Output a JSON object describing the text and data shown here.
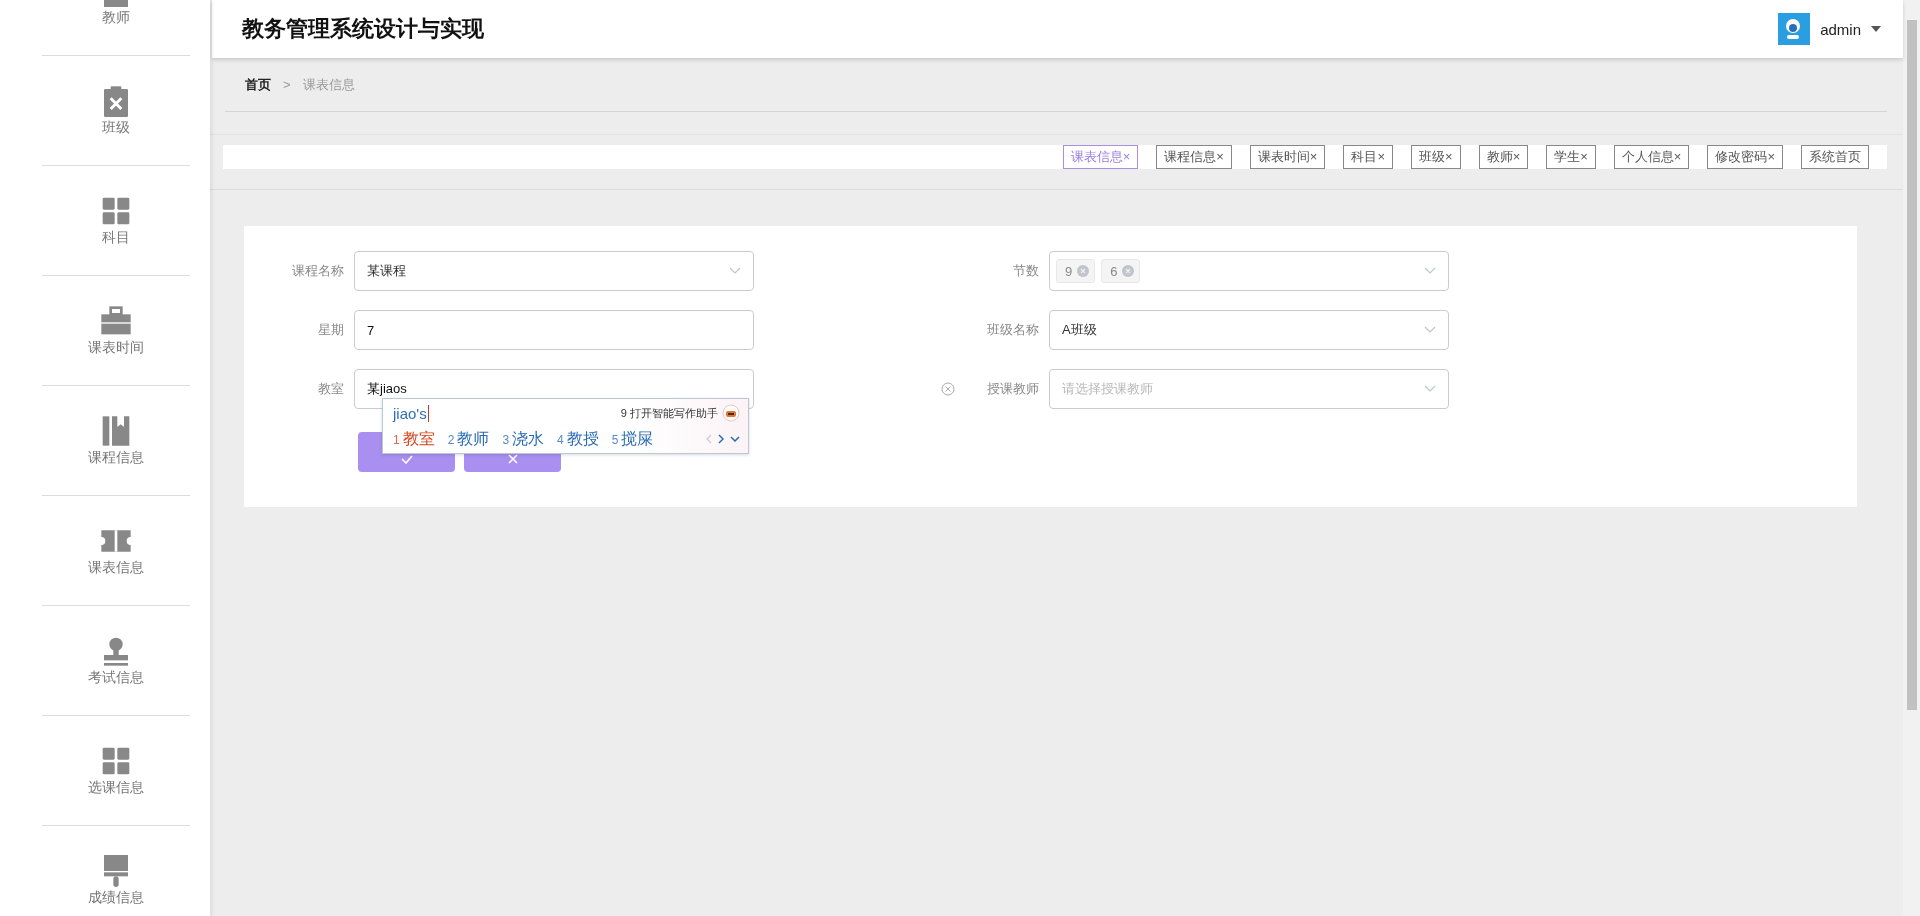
{
  "sidebar": {
    "items": [
      {
        "label": "教师"
      },
      {
        "label": "班级"
      },
      {
        "label": "科目"
      },
      {
        "label": "课表时间"
      },
      {
        "label": "课程信息"
      },
      {
        "label": "课表信息"
      },
      {
        "label": "考试信息"
      },
      {
        "label": "选课信息"
      },
      {
        "label": "成绩信息"
      }
    ]
  },
  "header": {
    "title": "教务管理系统设计与实现",
    "user": "admin"
  },
  "breadcrumb": {
    "home": "首页",
    "separator": ">",
    "current": "课表信息"
  },
  "tags": [
    {
      "label": "课表信息",
      "close": "×",
      "selected": true
    },
    {
      "label": "课程信息",
      "close": "×",
      "selected": false
    },
    {
      "label": "课表时间",
      "close": "×",
      "selected": false
    },
    {
      "label": "科目",
      "close": "×",
      "selected": false
    },
    {
      "label": "班级",
      "close": "×",
      "selected": false
    },
    {
      "label": "教师",
      "close": "×",
      "selected": false
    },
    {
      "label": "学生",
      "close": "×",
      "selected": false
    },
    {
      "label": "个人信息",
      "close": "×",
      "selected": false
    },
    {
      "label": "修改密码",
      "close": "×",
      "selected": false
    },
    {
      "label": "系统首页",
      "selected": false
    }
  ],
  "form": {
    "fields": [
      {
        "label": "课程名称",
        "kind": "select",
        "value": "某课程",
        "marked": false
      },
      {
        "label": "节数",
        "kind": "multiselect",
        "chips": [
          "9",
          "6"
        ],
        "marked": false
      },
      {
        "label": "星期",
        "kind": "text",
        "value": "7",
        "marked": false
      },
      {
        "label": "班级名称",
        "kind": "select",
        "value": "A班级",
        "marked": false
      },
      {
        "label": "教室",
        "kind": "text",
        "value": "某jiaos",
        "marked": false
      },
      {
        "label": "授课教师",
        "kind": "select",
        "placeholder": "请选择授课教师",
        "marked": true
      }
    ],
    "buttons": [
      {
        "kind": "submit"
      },
      {
        "kind": "cancel"
      }
    ]
  },
  "ime": {
    "composition": "jiao's",
    "hint_number": "9",
    "hint": "打开智能写作助手",
    "candidates": [
      {
        "number": "1",
        "text": "教室",
        "selected": true
      },
      {
        "number": "2",
        "text": "教师",
        "selected": false
      },
      {
        "number": "3",
        "text": "浇水",
        "selected": false
      },
      {
        "number": "4",
        "text": "教授",
        "selected": false
      },
      {
        "number": "5",
        "text": "搅屎",
        "selected": false
      }
    ]
  }
}
